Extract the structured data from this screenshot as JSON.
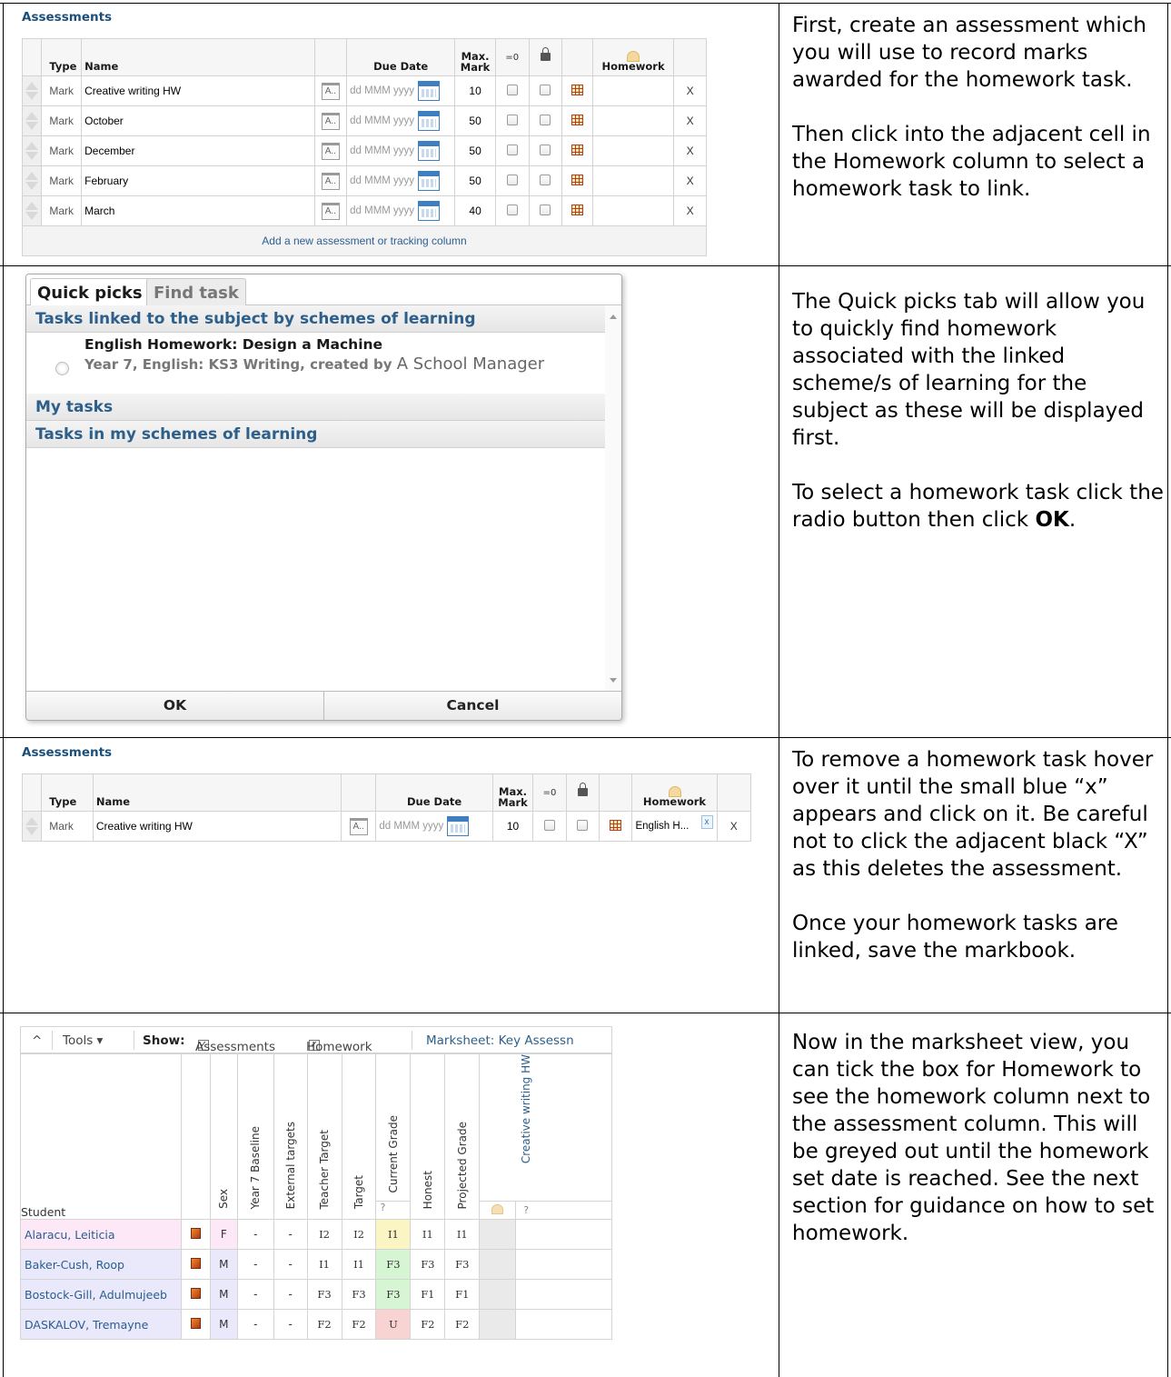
{
  "instructions": {
    "step1_p1": "First, create an assessment which you will use to record marks awarded for the homework task.",
    "step1_p2": "Then click into the adjacent cell in the Homework column to select a homework task to link.",
    "step2_p1": "The Quick picks tab will allow you to quickly find homework associated with the linked scheme/s of learning for the subject as these will be displayed first.",
    "step2_p2_pre": "To select a homework task click the radio button then click ",
    "step2_p2_bold": "OK",
    "step2_p2_post": ".",
    "step3_p1": "To remove a homework task hover over it until the small blue “x” appears and click on it. Be careful not to click the adjacent black “X” as this deletes the assessment.",
    "step3_p2": "Once your homework tasks are linked, save the markbook.",
    "step4_p1": "Now in the marksheet view, you can tick the box for Homework to see the homework column next to the assessment column. This will be greyed out until the homework set date is reached. See the next section for guidance on how to set homework."
  },
  "assessments_panel": {
    "title": "Assessments",
    "headers": {
      "type": "Type",
      "name": "Name",
      "due_date": "Due Date",
      "max_mark_1": "Max.",
      "max_mark_2": "Mark",
      "eq0": "=0",
      "homework": "Homework"
    },
    "rows": [
      {
        "type": "Mark",
        "name": "Creative writing HW",
        "abbr": "A..",
        "date": "dd MMM yyyy",
        "max": "10",
        "delete": "X"
      },
      {
        "type": "Mark",
        "name": "October",
        "abbr": "A..",
        "date": "dd MMM yyyy",
        "max": "50",
        "delete": "X"
      },
      {
        "type": "Mark",
        "name": "December",
        "abbr": "A..",
        "date": "dd MMM yyyy",
        "max": "50",
        "delete": "X"
      },
      {
        "type": "Mark",
        "name": "February",
        "abbr": "A..",
        "date": "dd MMM yyyy",
        "max": "50",
        "delete": "X"
      },
      {
        "type": "Mark",
        "name": "March",
        "abbr": "A..",
        "date": "dd MMM yyyy",
        "max": "40",
        "delete": "X"
      }
    ],
    "add_link": "Add a new assessment or tracking column"
  },
  "dialog": {
    "tabs": [
      "Quick picks",
      "Find task"
    ],
    "section_linked": "Tasks linked to the subject by schemes of learning",
    "task_title": "English Homework: Design a Machine",
    "task_detail": "Year 7, English: KS3 Writing, created by",
    "task_author": "A School Manager",
    "section_my_tasks": "My tasks",
    "section_my_schemes": "Tasks in my schemes of learning",
    "ok_label": "OK",
    "cancel_label": "Cancel"
  },
  "linked_assessment": {
    "title": "Assessments",
    "row": {
      "type": "Mark",
      "name": "Creative writing HW",
      "abbr": "A..",
      "date": "dd MMM yyyy",
      "max": "10",
      "homework": "English H...",
      "remove_x": "x",
      "delete": "X"
    }
  },
  "marksheet": {
    "toolbar": {
      "collapse": "^",
      "tools": "Tools ▾",
      "show_label": "Show:",
      "show_assessments": "Assessments",
      "show_homework": "Homework",
      "marksheet_title": "Marksheet: Key Assessn"
    },
    "columns": [
      "Sex",
      "Year 7 Baseline",
      "External targets",
      "Teacher Target",
      "Target",
      "Current Grade",
      "Honest",
      "Projected Grade",
      "Creative writing HW"
    ],
    "student_header": "Student",
    "question_mark": "?",
    "students": [
      {
        "name": "Alaracu, Leiticia",
        "sex": "F",
        "baseline": "-",
        "external": "-",
        "teacher_target": "I2",
        "target": "I2",
        "current": "I1",
        "honest": "I1",
        "projected": "I1"
      },
      {
        "name": "Baker-Cush, Roop",
        "sex": "M",
        "baseline": "-",
        "external": "-",
        "teacher_target": "I1",
        "target": "I1",
        "current": "F3",
        "honest": "F3",
        "projected": "F3"
      },
      {
        "name": "Bostock-Gill, Adulmujeeb",
        "sex": "M",
        "baseline": "-",
        "external": "-",
        "teacher_target": "F3",
        "target": "F3",
        "current": "F3",
        "honest": "F1",
        "projected": "F1"
      },
      {
        "name": "DASKALOV, Tremayne",
        "sex": "M",
        "baseline": "-",
        "external": "-",
        "teacher_target": "F2",
        "target": "F2",
        "current": "U",
        "honest": "F2",
        "projected": "F2"
      }
    ],
    "row_colors": {
      "female": "#fde8f7",
      "male": "#e9e9fb",
      "current_green": "#d6f5d3",
      "current_yellow": "#fbf5c4",
      "current_red": "#f9d2d2"
    }
  }
}
